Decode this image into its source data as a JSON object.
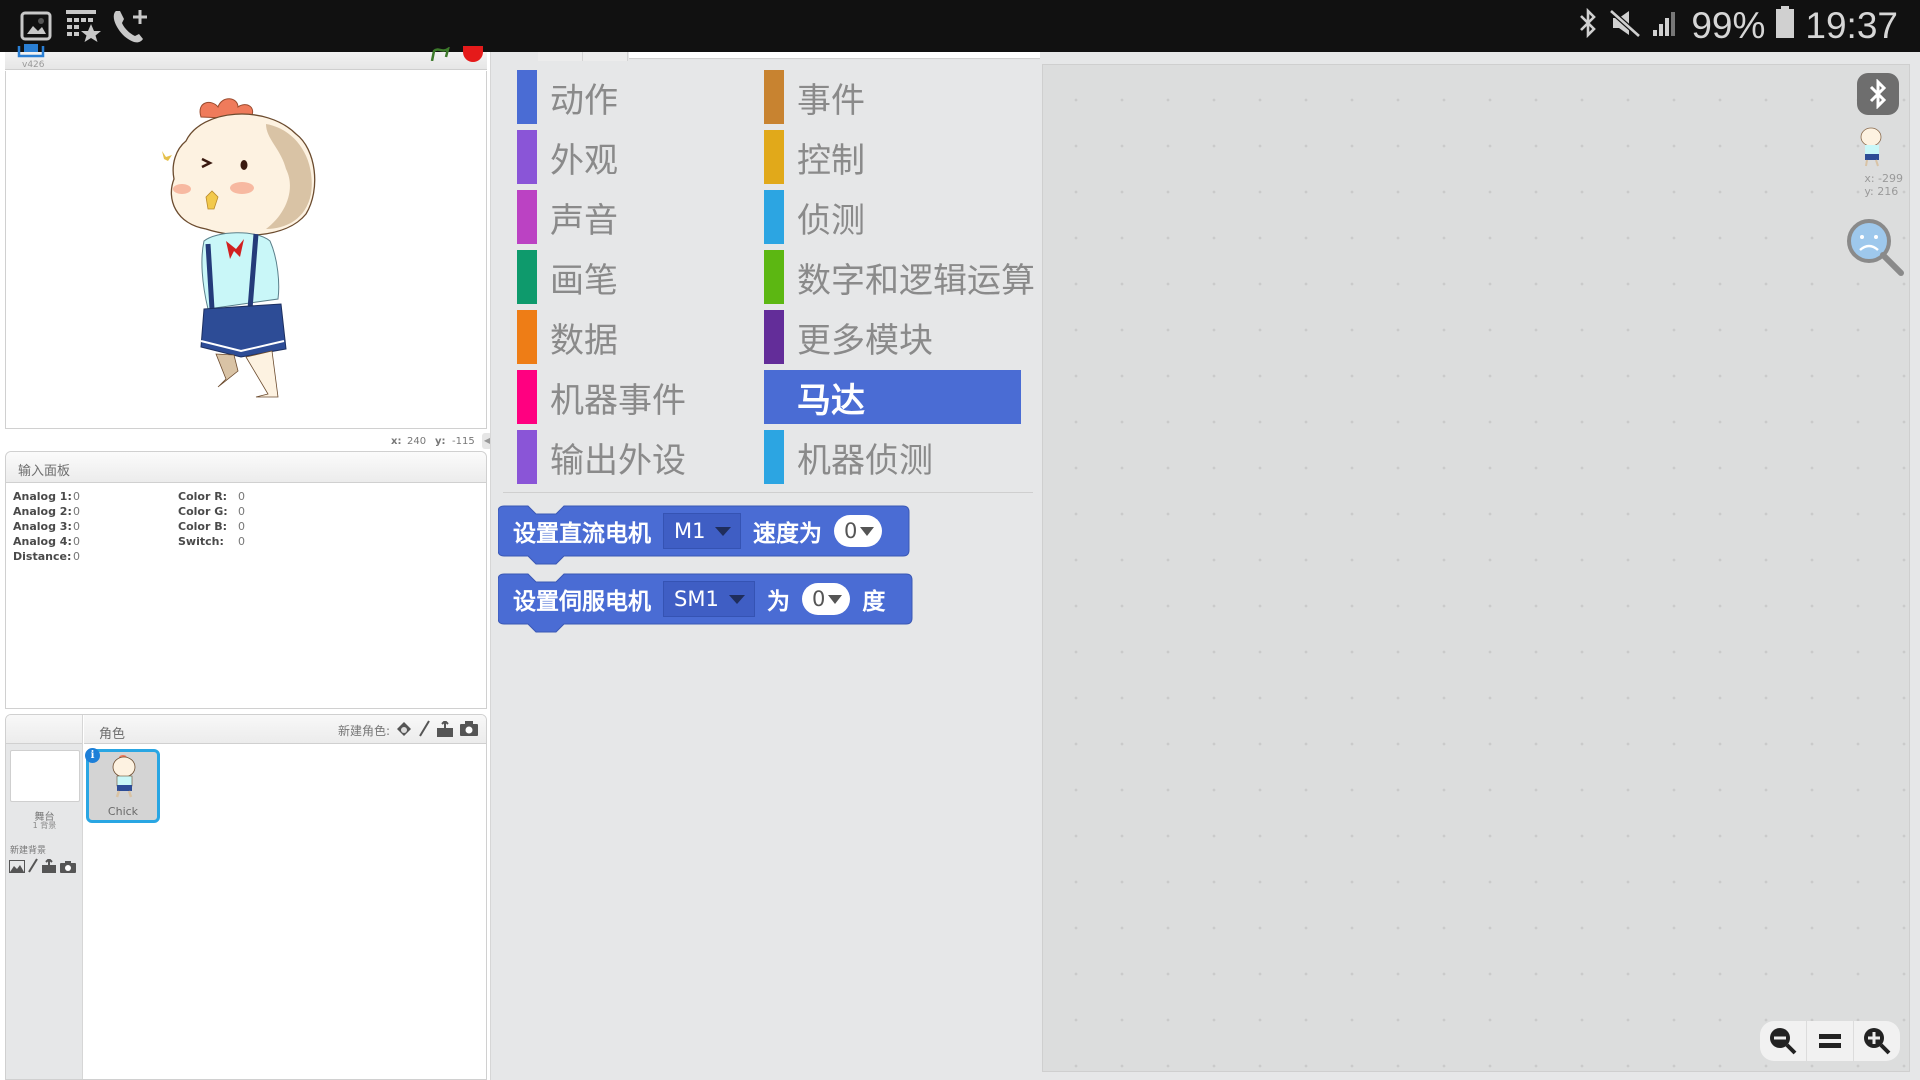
{
  "status_bar": {
    "left_icons": [
      "gallery-icon",
      "calendar-star-icon",
      "call-add-icon"
    ],
    "right_icons": [
      "bluetooth-icon",
      "mute-icon",
      "signal-icon",
      "battery-icon"
    ],
    "battery": "99%",
    "time": "19:37"
  },
  "stage": {
    "version": "v426",
    "sprite_name": "Chick",
    "mouse_x_label": "x:",
    "mouse_x": "240",
    "mouse_y_label": "y:",
    "mouse_y": "-115"
  },
  "input_panel": {
    "title": "输入面板",
    "left": [
      {
        "label": "Analog 1:",
        "value": "0"
      },
      {
        "label": "Analog 2:",
        "value": "0"
      },
      {
        "label": "Analog 3:",
        "value": "0"
      },
      {
        "label": "Analog 4:",
        "value": "0"
      },
      {
        "label": "Distance:",
        "value": "0"
      }
    ],
    "right": [
      {
        "label": "Color R:",
        "value": "0"
      },
      {
        "label": "Color G:",
        "value": "0"
      },
      {
        "label": "Color B:",
        "value": "0"
      },
      {
        "label": "Switch:",
        "value": "0"
      }
    ]
  },
  "sprites_panel": {
    "title": "角色",
    "new_sprite_label": "新建角色:",
    "stage_label": "舞台",
    "stage_backdrops": "1 背景",
    "new_backdrop_label": "新建背景",
    "sprites": [
      {
        "name": "Chick",
        "selected": true
      }
    ]
  },
  "palette": {
    "categories_left": [
      {
        "label": "动作",
        "color": "#4a6cd4"
      },
      {
        "label": "外观",
        "color": "#8a55d7"
      },
      {
        "label": "声音",
        "color": "#bb42c3"
      },
      {
        "label": "画笔",
        "color": "#0e9a6c"
      },
      {
        "label": "数据",
        "color": "#ee7d16"
      },
      {
        "label": "机器事件",
        "color": "#ff0080"
      },
      {
        "label": "输出外设",
        "color": "#8a55d7"
      }
    ],
    "categories_right": [
      {
        "label": "事件",
        "color": "#c88330"
      },
      {
        "label": "控制",
        "color": "#e1a91a"
      },
      {
        "label": "侦测",
        "color": "#2ca5e2"
      },
      {
        "label": "数字和逻辑运算",
        "color": "#5cb712"
      },
      {
        "label": "更多模块",
        "color": "#632d99"
      },
      {
        "label": "马达",
        "color": "#4a6cd4",
        "selected": true
      },
      {
        "label": "机器侦测",
        "color": "#2ca5e2"
      }
    ],
    "blocks": [
      {
        "text1": "设置直流电机",
        "dropdown": "M1",
        "text2": "速度为",
        "number": "0",
        "text3": ""
      },
      {
        "text1": "设置伺服电机",
        "dropdown": "SM1",
        "text2": "为",
        "number": "0",
        "text3": "度"
      }
    ],
    "block_color": "#4a6cd4"
  },
  "script_area": {
    "sprite_x": "x: -299",
    "sprite_y": "y: 216",
    "zoom_buttons": [
      "zoom-out",
      "zoom-reset",
      "zoom-in"
    ]
  }
}
